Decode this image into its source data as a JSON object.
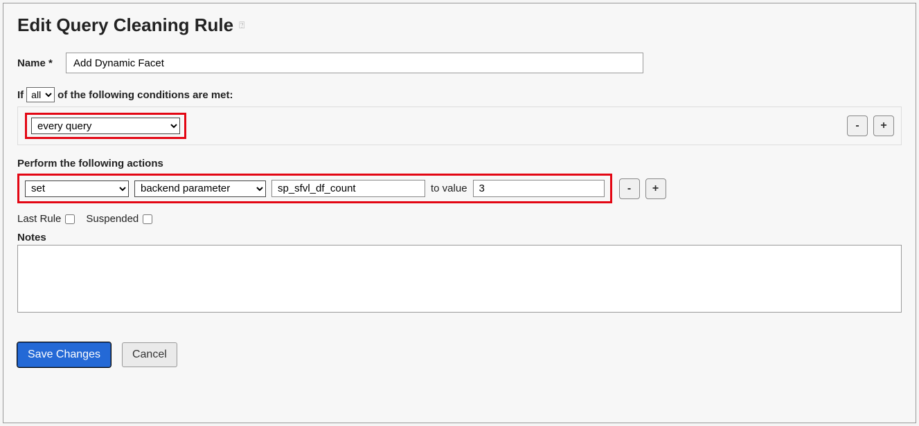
{
  "page": {
    "title": "Edit Query Cleaning Rule"
  },
  "form": {
    "name_label": "Name",
    "name_value": "Add Dynamic Facet",
    "condition_prefix": "If",
    "condition_match": "all",
    "condition_suffix": "of the following conditions are met:",
    "condition_type": "every query",
    "action_header": "Perform the following actions",
    "action_verb": "set",
    "action_target": "backend parameter",
    "action_param": "sp_sfvl_df_count",
    "to_value_label": "to value",
    "action_value": "3",
    "last_rule_label": "Last Rule",
    "suspended_label": "Suspended",
    "notes_label": "Notes",
    "notes_value": ""
  },
  "buttons": {
    "remove": "-",
    "add": "+",
    "save": "Save Changes",
    "cancel": "Cancel"
  }
}
